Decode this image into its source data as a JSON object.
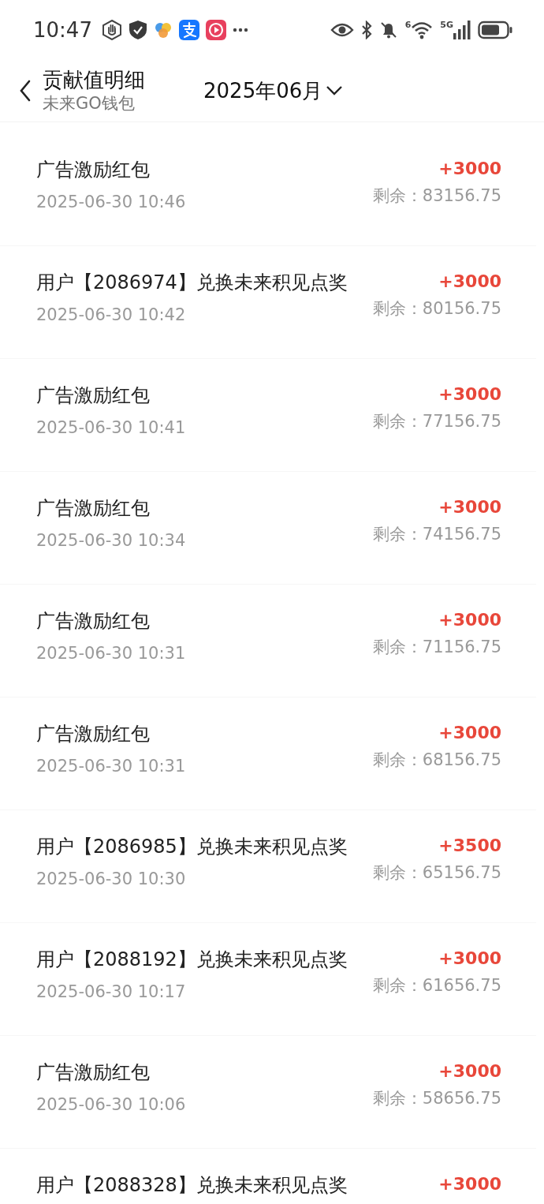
{
  "status_bar": {
    "time": "10:47",
    "network_label": "5G",
    "wifi_label": "6"
  },
  "header": {
    "title": "贡献值明细",
    "subtitle": "未来GO钱包",
    "month": "2025年06月"
  },
  "records": [
    {
      "title": "广告激励红包",
      "time": "2025-06-30 10:46",
      "amount": "+3000",
      "balance": "剩余：83156.75"
    },
    {
      "title": "用户【2086974】兑换未来积见点奖",
      "time": "2025-06-30 10:42",
      "amount": "+3000",
      "balance": "剩余：80156.75"
    },
    {
      "title": "广告激励红包",
      "time": "2025-06-30 10:41",
      "amount": "+3000",
      "balance": "剩余：77156.75"
    },
    {
      "title": "广告激励红包",
      "time": "2025-06-30 10:34",
      "amount": "+3000",
      "balance": "剩余：74156.75"
    },
    {
      "title": "广告激励红包",
      "time": "2025-06-30 10:31",
      "amount": "+3000",
      "balance": "剩余：71156.75"
    },
    {
      "title": "广告激励红包",
      "time": "2025-06-30 10:31",
      "amount": "+3000",
      "balance": "剩余：68156.75"
    },
    {
      "title": "用户【2086985】兑换未来积见点奖",
      "time": "2025-06-30 10:30",
      "amount": "+3500",
      "balance": "剩余：65156.75"
    },
    {
      "title": "用户【2088192】兑换未来积见点奖",
      "time": "2025-06-30 10:17",
      "amount": "+3000",
      "balance": "剩余：61656.75"
    },
    {
      "title": "广告激励红包",
      "time": "2025-06-30 10:06",
      "amount": "+3000",
      "balance": "剩余：58656.75"
    },
    {
      "title": "用户【2088328】兑换未来积见点奖",
      "amount": "+3000"
    }
  ]
}
